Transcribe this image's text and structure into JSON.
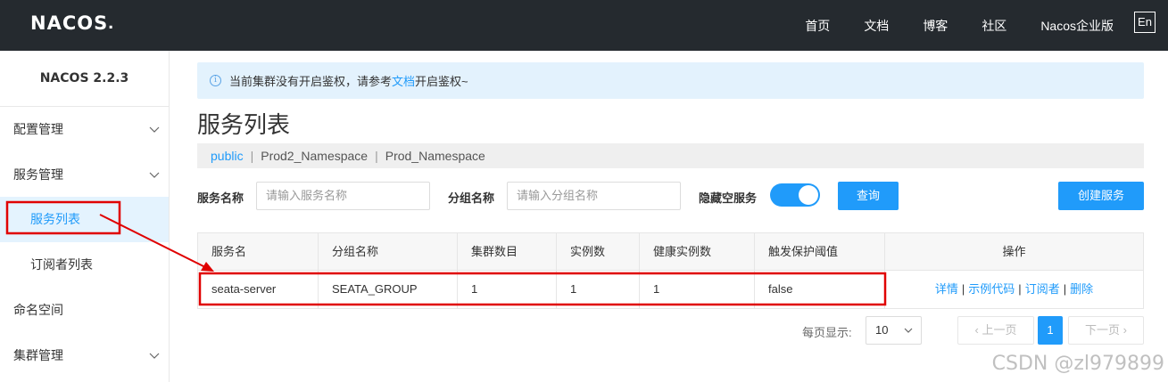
{
  "header": {
    "logo_text": "NACOS",
    "logo_dot": ".",
    "nav": [
      "首页",
      "文档",
      "博客",
      "社区",
      "Nacos企业版"
    ],
    "lang": "En"
  },
  "sidebar": {
    "title": "NACOS 2.2.3",
    "items": [
      {
        "label": "配置管理"
      },
      {
        "label": "服务管理"
      },
      {
        "label": "服务列表"
      },
      {
        "label": "订阅者列表"
      },
      {
        "label": "命名空间"
      },
      {
        "label": "集群管理"
      }
    ]
  },
  "notice": {
    "prefix": "当前集群没有开启鉴权，请参考",
    "link": "文档",
    "suffix": "开启鉴权~"
  },
  "page_title": "服务列表",
  "namespaces": [
    "public",
    "Prod2_Namespace",
    "Prod_Namespace"
  ],
  "filters": {
    "service_label": "服务名称",
    "service_placeholder": "请输入服务名称",
    "group_label": "分组名称",
    "group_placeholder": "请输入分组名称",
    "hide_empty_label": "隐藏空服务",
    "hide_empty_on": true,
    "query_button": "查询",
    "create_button": "创建服务"
  },
  "table": {
    "columns": [
      "服务名",
      "分组名称",
      "集群数目",
      "实例数",
      "健康实例数",
      "触发保护阈值",
      "操作"
    ],
    "rows": [
      {
        "name": "seata-server",
        "group": "SEATA_GROUP",
        "clusters": "1",
        "instances": "1",
        "healthy": "1",
        "threshold": "false",
        "ops": [
          "详情",
          "示例代码",
          "订阅者",
          "删除"
        ]
      }
    ]
  },
  "pager": {
    "label": "每页显示:",
    "page_size": "10",
    "prev": "上一页",
    "current": "1",
    "next": "下一页"
  },
  "watermark": "CSDN @zl979899",
  "colors": {
    "accent": "#209bfa",
    "topbar": "#252a2f",
    "annotation": "#e00000"
  }
}
